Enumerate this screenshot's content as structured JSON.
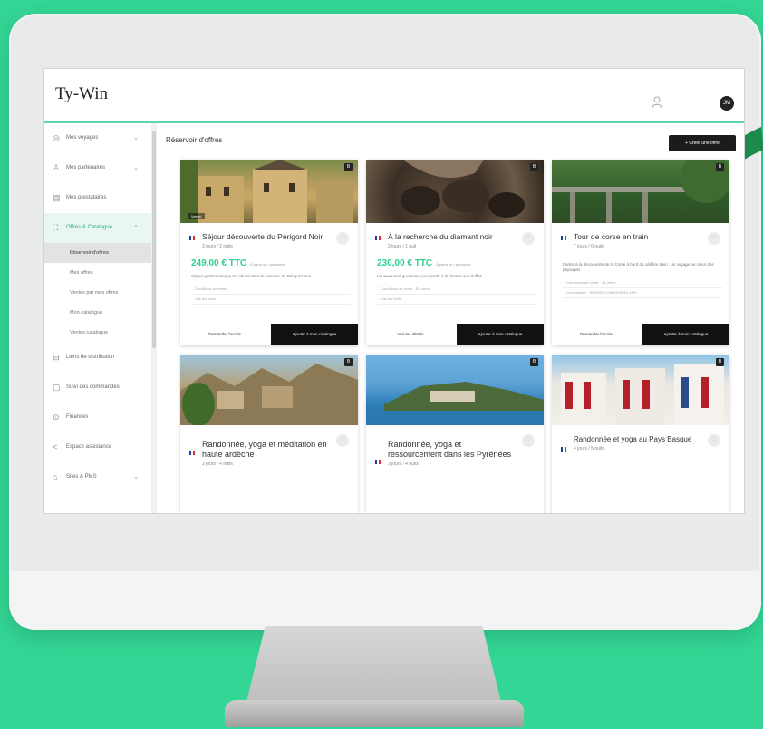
{
  "app": {
    "logo": "Ty-Win",
    "avatar_initials": "JM"
  },
  "sidebar": {
    "items": [
      {
        "label": "Mes voyages",
        "icon": "globe-icon",
        "chevron": "⌄"
      },
      {
        "label": "Mes partenaires",
        "icon": "users-icon",
        "chevron": "⌄"
      },
      {
        "label": "Mes prestataires",
        "icon": "doc-icon",
        "chevron": ""
      },
      {
        "label": "Offres & Catalogue",
        "icon": "offer-icon",
        "chevron": "⌃"
      }
    ],
    "subitems": [
      {
        "label": "Réservoir d'offres"
      },
      {
        "label": "Mes offres"
      },
      {
        "label": "Ventes par mes offres"
      },
      {
        "label": "Mon catalogue"
      },
      {
        "label": "Ventes catalogue"
      }
    ],
    "items_bottom": [
      {
        "label": "Liens de distribution",
        "icon": "link-icon",
        "chevron": ""
      },
      {
        "label": "Suivi des commandes",
        "icon": "clipboard-icon",
        "chevron": ""
      },
      {
        "label": "Finances",
        "icon": "coin-icon",
        "chevron": ""
      },
      {
        "label": "Espace assistance",
        "icon": "share-icon",
        "chevron": ""
      },
      {
        "label": "Sites & PMS",
        "icon": "site-icon",
        "chevron": "⌄"
      }
    ]
  },
  "main": {
    "title": "Réservoir d'offres",
    "create_button": "+ Créer une offre"
  },
  "cards": [
    {
      "title": "Séjour découverte du Périgord Noir",
      "sub": "3 jours / 2 nuits",
      "badge": "B",
      "tag": "Vendu",
      "price": "249,00 € TTC",
      "price_note": "À partir de / personne",
      "desc": "Séjour gastronomique et culturel dans le berceau du Périgord Noir",
      "rows": [
        "Conditions de vente",
        "Voir les tarifs"
      ],
      "secondary": "Demander l'accès",
      "primary": "Ajouter à mon catalogue"
    },
    {
      "title": "À la recherche du diamant noir",
      "sub": "2 jours / 1 nuit",
      "badge": "B",
      "tag": "",
      "price": "230,00 € TTC",
      "price_note": "À partir de / personne",
      "desc": "Un week-end gourmand pour partir à la chasse aux truffes",
      "rows": [
        "Conditions de vente · En vente",
        "Voir les tarifs"
      ],
      "secondary": "Voir les détails",
      "primary": "Ajouter à mon catalogue"
    },
    {
      "title": "Tour de corse en train",
      "sub": "7 jours / 6 nuits",
      "badge": "B",
      "tag": "",
      "price": "",
      "price_note": "",
      "desc": "Partez à la découverte de la Corse à bord du célèbre train : un voyage au cœur des paysages",
      "rows": [
        "Conditions de vente · 48 offres",
        "Commission · REMISE/COMMISSION 15%"
      ],
      "secondary": "Demander l'accès",
      "primary": "Ajouter à mon catalogue"
    },
    {
      "title": "Randonnée, yoga et méditation en haute ardèche",
      "sub": "3 jours / 4 nuits",
      "badge": "B",
      "tag": "",
      "price": "",
      "price_note": "",
      "desc": "",
      "rows": [],
      "secondary": "",
      "primary": ""
    },
    {
      "title": "Randonnée, yoga et ressourcement dans les Pyrénées",
      "sub": "3 jours / 4 nuits",
      "badge": "B",
      "tag": "",
      "price": "",
      "price_note": "",
      "desc": "",
      "rows": [],
      "secondary": "",
      "primary": ""
    },
    {
      "title": "Randonnée et yoga au Pays Basque",
      "sub": "4 jours / 5 nuits",
      "badge": "B",
      "tag": "",
      "price": "",
      "price_note": "",
      "desc": "",
      "rows": [],
      "secondary": "",
      "primary": ""
    }
  ],
  "colors": {
    "background": "#33d694",
    "accent": "#2fd08d",
    "dark": "#111111"
  }
}
